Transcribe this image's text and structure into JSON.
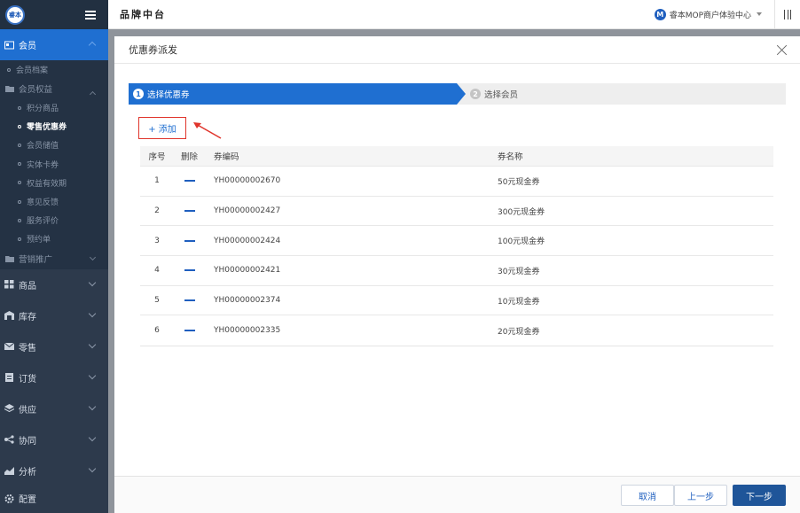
{
  "logo_text": "睿本",
  "sidebar": {
    "member": "会员",
    "member_archive": "会员档案",
    "member_rights": "会员权益",
    "rights_items": [
      "积分商品",
      "零售优惠券",
      "会员储值",
      "实体卡券",
      "权益有效期",
      "意见反馈",
      "服务评价",
      "预约单"
    ],
    "marketing": "营销推广",
    "sections": [
      "商品",
      "库存",
      "零售",
      "订货",
      "供应",
      "协同",
      "分析"
    ],
    "config": "配置"
  },
  "topbar": {
    "title": "品牌中台",
    "store_initial": "M",
    "store_name": "睿本MOP商户体验中心"
  },
  "dialog": {
    "title": "优惠券派发",
    "steps": [
      {
        "num": "1",
        "label": "选择优惠券"
      },
      {
        "num": "2",
        "label": "选择会员"
      }
    ],
    "add_label": "+ 添加",
    "table": {
      "headers": [
        "序号",
        "删除",
        "券编码",
        "券名称"
      ],
      "rows": [
        {
          "no": "1",
          "code": "YH00000002670",
          "name": "50元现金券"
        },
        {
          "no": "2",
          "code": "YH00000002427",
          "name": "300元现金券"
        },
        {
          "no": "3",
          "code": "YH00000002424",
          "name": "100元现金券"
        },
        {
          "no": "4",
          "code": "YH00000002421",
          "name": "30元现金券"
        },
        {
          "no": "5",
          "code": "YH00000002374",
          "name": "10元现金券"
        },
        {
          "no": "6",
          "code": "YH00000002335",
          "name": "20元现金券"
        }
      ]
    },
    "buttons": {
      "cancel": "取消",
      "prev": "上一步",
      "next": "下一步"
    }
  },
  "colors": {
    "accent": "#1f6fd1",
    "sidebar_bg": "#2d3a4c",
    "highlight_border": "#e0342b",
    "primary_button": "#1f5599"
  },
  "icons": [
    "menu-icon",
    "close-icon",
    "delete-icon",
    "dropdown-caret-icon",
    "apps-icon"
  ]
}
